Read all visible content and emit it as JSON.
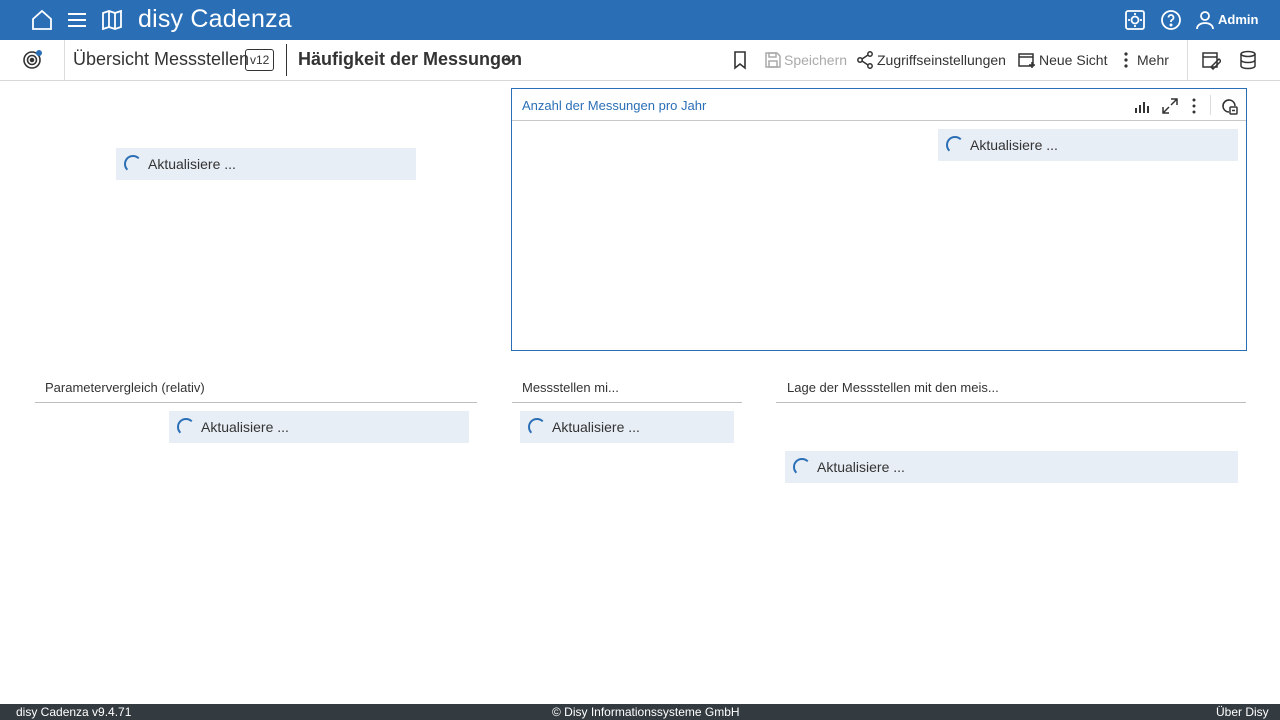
{
  "app": {
    "brand": "disy Cadenza",
    "user": "Admin"
  },
  "colors": {
    "primary": "#2a6fb6",
    "footer_bg": "#333a40",
    "loading_bg": "#e8eef6"
  },
  "topbar": {
    "icons": [
      "home-icon",
      "menu-icon",
      "map-icon",
      "settings-icon",
      "help-icon",
      "user-icon"
    ]
  },
  "toolbar": {
    "workspace_title": "Übersicht Messstellen",
    "version_badge": "v12",
    "view_title": "Häufigkeit der Messungen",
    "bookmark": "",
    "save_label": "Speichern",
    "access_label": "Zugriffseinstellungen",
    "new_view_label": "Neue Sicht",
    "more_label": "Mehr"
  },
  "panels": {
    "left_top": {
      "loading": "Aktualisiere ..."
    },
    "chart": {
      "title": "Anzahl der Messungen pro Jahr",
      "loading": "Aktualisiere ..."
    },
    "param": {
      "title": "Parametervergleich (relativ)",
      "loading": "Aktualisiere ..."
    },
    "stations": {
      "title": "Messstellen mi...",
      "loading": "Aktualisiere ..."
    },
    "location": {
      "title": "Lage der Messstellen mit den meis...",
      "loading": "Aktualisiere ..."
    }
  },
  "footer": {
    "version": "disy Cadenza v9.4.71",
    "copyright": "© Disy Informationssysteme GmbH",
    "about": "Über Disy"
  }
}
